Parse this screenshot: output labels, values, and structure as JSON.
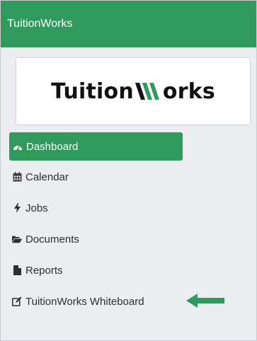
{
  "app": {
    "title": "TuitionWorks",
    "logo_text": "TuitionWorks"
  },
  "colors": {
    "brand_green": "#2f9a5c",
    "sidebar_bg": "#ebedf0",
    "text": "#2b2f33"
  },
  "sidebar": {
    "active_item": "Dashboard",
    "items": [
      {
        "label": "Dashboard",
        "icon": "tachometer-icon"
      },
      {
        "label": "Calendar",
        "icon": "calendar-icon"
      },
      {
        "label": "Jobs",
        "icon": "bolt-icon"
      },
      {
        "label": "Documents",
        "icon": "folder-open-icon"
      },
      {
        "label": "Reports",
        "icon": "file-icon"
      },
      {
        "label": "TuitionWorks Whiteboard",
        "icon": "edit-icon"
      }
    ]
  },
  "annotation": {
    "icon": "arrow-left-icon"
  }
}
